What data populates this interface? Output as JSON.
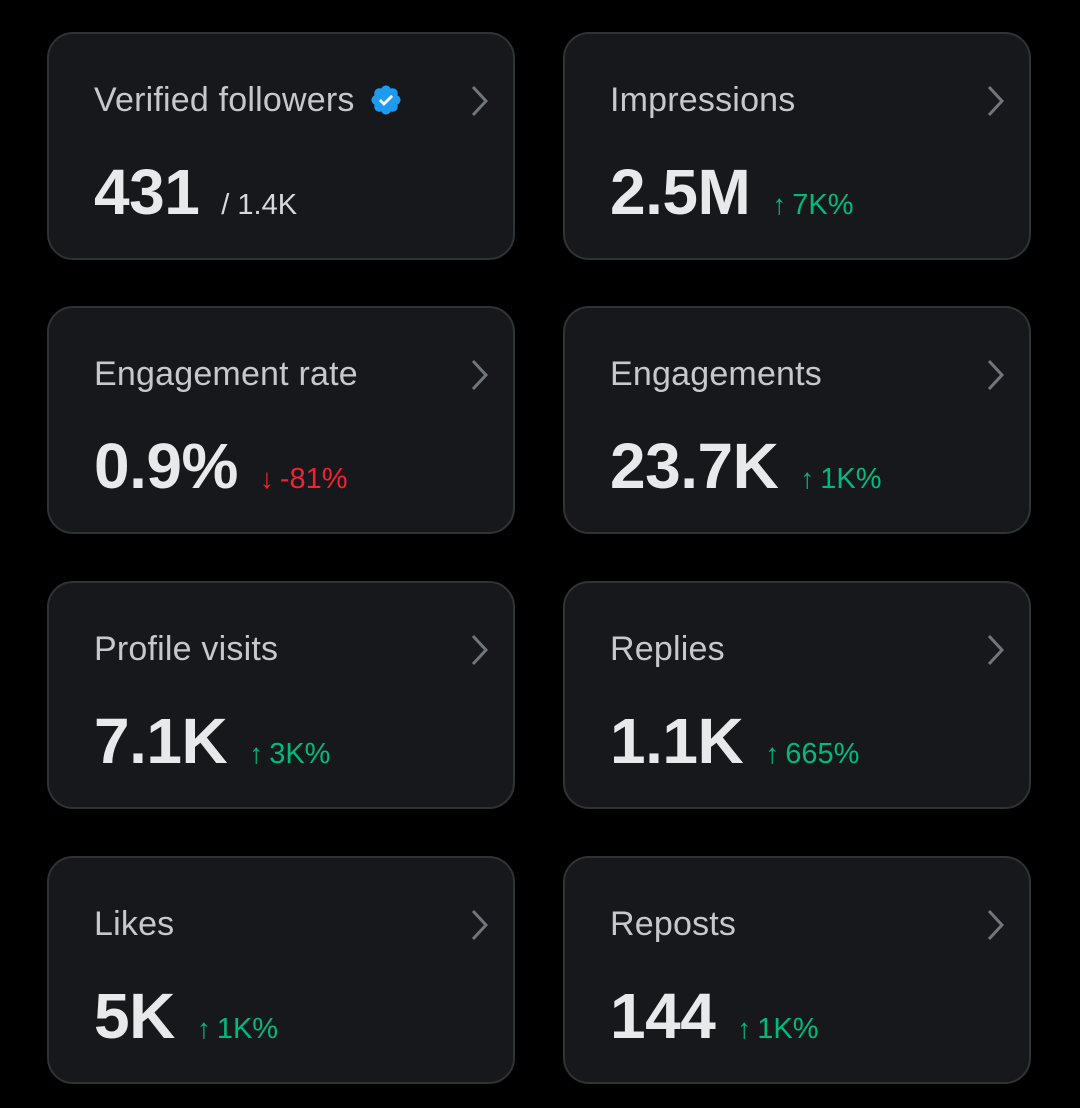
{
  "colors": {
    "background": "#000000",
    "card_bg": "#16181c",
    "card_border": "#2f3336",
    "title": "#c6c9cc",
    "value": "#e7e9ea",
    "up": "#00ba7c",
    "down": "#f4212e",
    "verified": "#1d9bf0"
  },
  "cards": [
    {
      "title": "Verified followers",
      "value": "431",
      "sub": "/ 1.4K",
      "icon": "verified-badge-icon"
    },
    {
      "title": "Impressions",
      "value": "2.5M",
      "change": {
        "arrow": "↑",
        "text": "7K%",
        "direction": "up"
      }
    },
    {
      "title": "Engagement rate",
      "value": "0.9%",
      "change": {
        "arrow": "↓",
        "text": "-81%",
        "direction": "down"
      }
    },
    {
      "title": "Engagements",
      "value": "23.7K",
      "change": {
        "arrow": "↑",
        "text": "1K%",
        "direction": "up"
      }
    },
    {
      "title": "Profile visits",
      "value": "7.1K",
      "change": {
        "arrow": "↑",
        "text": "3K%",
        "direction": "up"
      }
    },
    {
      "title": "Replies",
      "value": "1.1K",
      "change": {
        "arrow": "↑",
        "text": "665%",
        "direction": "up"
      }
    },
    {
      "title": "Likes",
      "value": "5K",
      "change": {
        "arrow": "↑",
        "text": "1K%",
        "direction": "up"
      }
    },
    {
      "title": "Reposts",
      "value": "144",
      "change": {
        "arrow": "↑",
        "text": "1K%",
        "direction": "up"
      }
    }
  ]
}
